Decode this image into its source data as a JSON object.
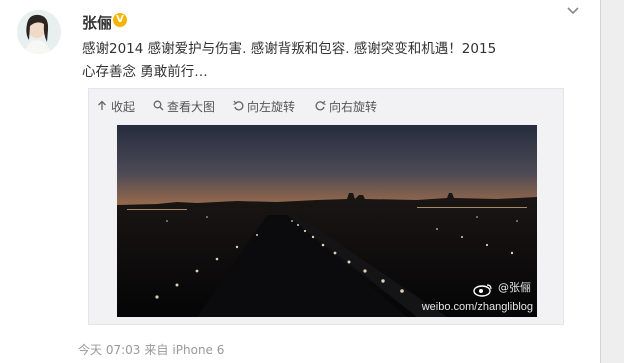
{
  "post": {
    "username": "张俪",
    "verified_badge": "V",
    "text": "感谢2014 感谢爱护与伤害. 感谢背叛和包容. 感谢突变和机遇！2015 心存善念 勇敢前行…",
    "menu_icon": "chevron-down-icon"
  },
  "media_toolbar": {
    "collapse": "收起",
    "view_large": "查看大图",
    "rotate_left": "向左旋转",
    "rotate_right": "向右旋转"
  },
  "photo": {
    "watermark_name": "@张俪",
    "watermark_url": "weibo.com/zhangliblog"
  },
  "footer": {
    "time": "今天 07:03",
    "source_prefix": "来自",
    "source": "iPhone 6"
  },
  "colors": {
    "text": "#333333",
    "muted": "#999999",
    "badge": "#f6b400",
    "sunset_orange": "#f08a2a"
  }
}
